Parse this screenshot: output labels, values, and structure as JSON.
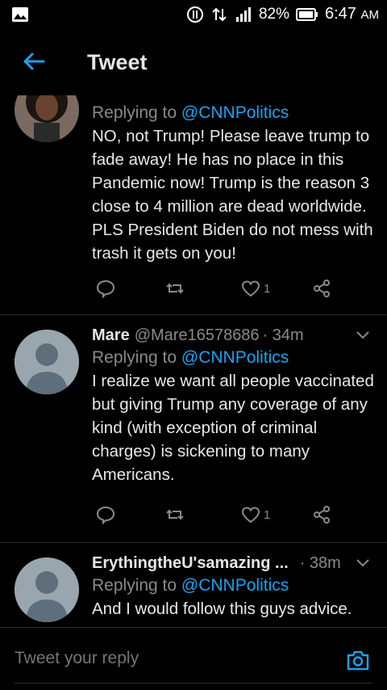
{
  "status_bar": {
    "battery": "82%",
    "time": "6:47",
    "ampm": "AM",
    "icons": [
      "gallery-icon",
      "data-saver-icon",
      "data-arrows-icon",
      "signal-icon",
      "battery-icon"
    ]
  },
  "header": {
    "title": "Tweet",
    "back_icon": "back-arrow-icon"
  },
  "tweets": [
    {
      "name": "",
      "handle": "",
      "time": "",
      "replying_prefix": "Replying to",
      "replying_handle": "@CNNPolitics",
      "text": "NO, not Trump! Please leave trump to fade away! He has no place in this Pandemic now! Trump is the reason 3 close to 4 million are dead worldwide. PLS President Biden do not mess with trash it gets on you!",
      "likes": "1"
    },
    {
      "name": "Mare",
      "handle": "@Mare16578686",
      "time": "· 34m",
      "replying_prefix": "Replying to",
      "replying_handle": "@CNNPolitics",
      "text": "I realize we want all people vaccinated but giving Trump any coverage of any kind (with exception of criminal charges) is sickening to many Americans.",
      "likes": "1"
    },
    {
      "name": "ErythingtheU'samazing ...",
      "handle": "",
      "time": "· 38m",
      "replying_prefix": "Replying to",
      "replying_handle": "@CNNPolitics",
      "text": "And I would follow this guys advice."
    }
  ],
  "reply_bar": {
    "placeholder": "Tweet your reply",
    "camera_icon": "camera-icon"
  },
  "colors": {
    "accent": "#1da1f2",
    "muted": "#8a8a8a",
    "background": "#000000"
  }
}
